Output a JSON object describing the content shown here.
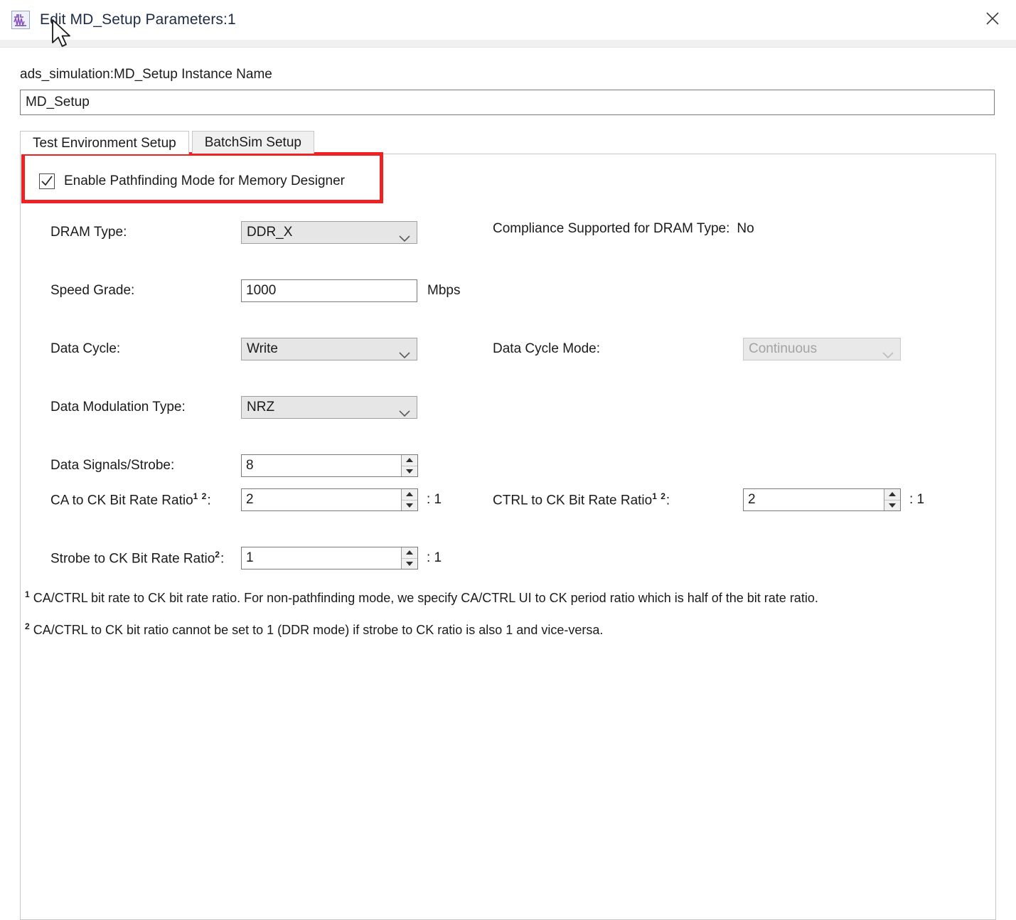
{
  "window": {
    "title": "Edit MD_Setup Parameters:1",
    "icon": "waveform-schematic-icon",
    "close_label": "✕"
  },
  "instance": {
    "label": "ads_simulation:MD_Setup Instance Name",
    "value": "MD_Setup",
    "placeholder": ""
  },
  "tabs": [
    {
      "label": "Test Environment Setup",
      "active": true
    },
    {
      "label": "BatchSim Setup",
      "active": false
    }
  ],
  "pathfinding": {
    "label": "Enable Pathfinding Mode for Memory Designer",
    "checked": true,
    "highlight_color": "#ee2222"
  },
  "fields": {
    "dram_type": {
      "label": "DRAM Type:",
      "value": "DDR_X"
    },
    "compliance": {
      "label": "Compliance Supported for DRAM Type:",
      "value": "No"
    },
    "speed_grade": {
      "label": "Speed Grade:",
      "value": "1000",
      "unit": "Mbps"
    },
    "data_cycle": {
      "label": "Data Cycle:",
      "value": "Write"
    },
    "data_cycle_mode": {
      "label": "Data Cycle Mode:",
      "value": "Continuous",
      "disabled": true
    },
    "data_modulation_type": {
      "label": "Data Modulation Type:",
      "value": "NRZ"
    },
    "data_signals_strobe": {
      "label": "Data Signals/Strobe:",
      "value": "8"
    },
    "ca_to_ck": {
      "label": "CA to CK Bit Rate Ratio",
      "sup": "1 2",
      "colon": ":",
      "value": "2",
      "ratio": ": 1"
    },
    "ctrl_to_ck": {
      "label": "CTRL to CK Bit Rate Ratio",
      "sup": "1 2",
      "colon": ":",
      "value": "2",
      "ratio": ": 1"
    },
    "strobe_to_ck": {
      "label": "Strobe to CK Bit Rate Ratio",
      "sup": "2",
      "colon": ":",
      "value": "1",
      "ratio": ": 1"
    }
  },
  "footnotes": [
    {
      "marker": "1",
      "text": " CA/CTRL bit rate to CK bit rate ratio. For non-pathfinding mode, we specify CA/CTRL UI to CK period ratio which is half of the bit rate ratio."
    },
    {
      "marker": "2",
      "text": " CA/CTRL to CK bit ratio cannot be set to 1 (DDR mode) if strobe to CK ratio is also 1 and vice-versa."
    }
  ]
}
